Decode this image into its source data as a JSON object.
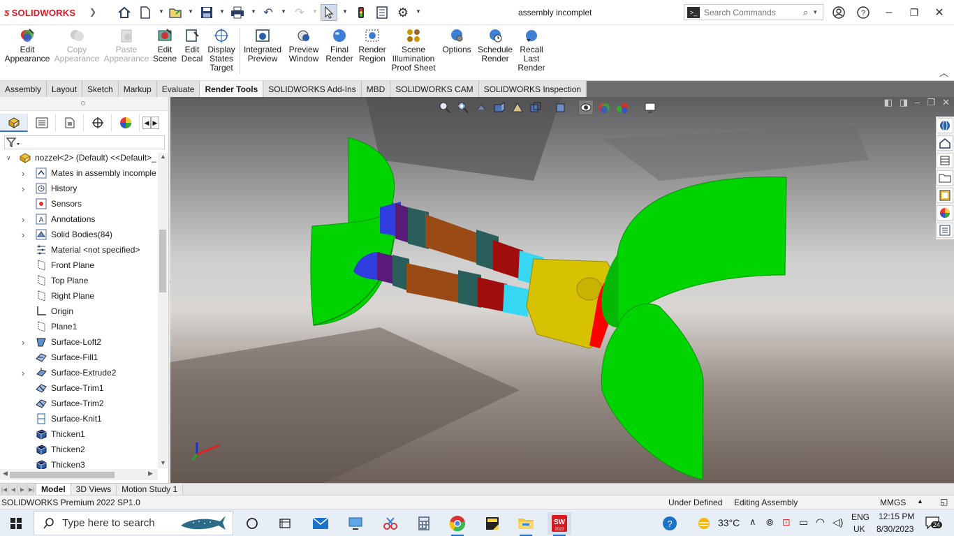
{
  "window": {
    "brand": "SOLIDWORKS",
    "title": "assembly incomplet",
    "search_placeholder": "Search Commands"
  },
  "ribbon": {
    "buttons": [
      {
        "label": "Edit\nAppearance",
        "enabled": true
      },
      {
        "label": "Copy\nAppearance",
        "enabled": false
      },
      {
        "label": "Paste\nAppearance",
        "enabled": false
      },
      {
        "label": "Edit\nScene",
        "enabled": true
      },
      {
        "label": "Edit\nDecal",
        "enabled": true
      },
      {
        "label": "Display\nStates\nTarget",
        "enabled": true
      },
      {
        "label": "Integrated\nPreview",
        "enabled": true
      },
      {
        "label": "Preview\nWindow",
        "enabled": true
      },
      {
        "label": "Final\nRender",
        "enabled": true
      },
      {
        "label": "Render\nRegion",
        "enabled": true
      },
      {
        "label": "Scene\nIllumination\nProof Sheet",
        "enabled": true
      },
      {
        "label": "Options",
        "enabled": true
      },
      {
        "label": "Schedule\nRender",
        "enabled": true
      },
      {
        "label": "Recall\nLast\nRender",
        "enabled": true
      }
    ]
  },
  "tabs": [
    "Assembly",
    "Layout",
    "Sketch",
    "Markup",
    "Evaluate",
    "Render Tools",
    "SOLIDWORKS Add-Ins",
    "MBD",
    "SOLIDWORKS CAM",
    "SOLIDWORKS Inspection"
  ],
  "active_tab": "Render Tools",
  "tree": {
    "root": "nozzel<2> (Default) <<Default>_",
    "items": [
      {
        "label": "Mates in assembly incomple",
        "expandable": true,
        "icon": "mates-icon"
      },
      {
        "label": "History",
        "expandable": true,
        "icon": "history-icon"
      },
      {
        "label": "Sensors",
        "expandable": false,
        "icon": "sensors-icon"
      },
      {
        "label": "Annotations",
        "expandable": true,
        "icon": "annotations-icon"
      },
      {
        "label": "Solid Bodies(84)",
        "expandable": true,
        "icon": "solid-bodies-icon"
      },
      {
        "label": "Material <not specified>",
        "expandable": false,
        "icon": "material-icon"
      },
      {
        "label": "Front Plane",
        "expandable": false,
        "icon": "plane-icon"
      },
      {
        "label": "Top Plane",
        "expandable": false,
        "icon": "plane-icon"
      },
      {
        "label": "Right Plane",
        "expandable": false,
        "icon": "plane-icon"
      },
      {
        "label": "Origin",
        "expandable": false,
        "icon": "origin-icon"
      },
      {
        "label": "Plane1",
        "expandable": false,
        "icon": "plane-icon"
      },
      {
        "label": "Surface-Loft2",
        "expandable": true,
        "icon": "surface-loft-icon"
      },
      {
        "label": "Surface-Fill1",
        "expandable": false,
        "icon": "surface-fill-icon"
      },
      {
        "label": "Surface-Extrude2",
        "expandable": true,
        "icon": "surface-extrude-icon"
      },
      {
        "label": "Surface-Trim1",
        "expandable": false,
        "icon": "surface-trim-icon"
      },
      {
        "label": "Surface-Trim2",
        "expandable": false,
        "icon": "surface-trim-icon"
      },
      {
        "label": "Surface-Knit1",
        "expandable": false,
        "icon": "surface-knit-icon"
      },
      {
        "label": "Thicken1",
        "expandable": false,
        "icon": "thicken-icon"
      },
      {
        "label": "Thicken2",
        "expandable": false,
        "icon": "thicken-icon"
      },
      {
        "label": "Thicken3",
        "expandable": false,
        "icon": "thicken-icon"
      }
    ]
  },
  "bottom_tabs": [
    "Model",
    "3D Views",
    "Motion Study 1"
  ],
  "active_bottom_tab": "Model",
  "status": {
    "product": "SOLIDWORKS Premium 2022 SP1.0",
    "definition": "Under Defined",
    "mode": "Editing Assembly",
    "units": "MMGS"
  },
  "taskbar": {
    "search_placeholder": "Type here to search",
    "weather": "33°C",
    "language_line1": "ENG",
    "language_line2": "UK",
    "time": "12:15 PM",
    "date": "8/30/2023",
    "notification_count": "24"
  },
  "colors": {
    "accent": "#d71920",
    "part_green": "#00d400",
    "part_yellow": "#d6c200",
    "part_cyan": "#36d7f2",
    "part_brown": "#9a4a14",
    "part_dark_red": "#a00d0d",
    "part_purple": "#5a1a7a",
    "part_blue": "#2f3de0",
    "part_teal": "#2a5e5a",
    "part_red": "#ff0000"
  }
}
